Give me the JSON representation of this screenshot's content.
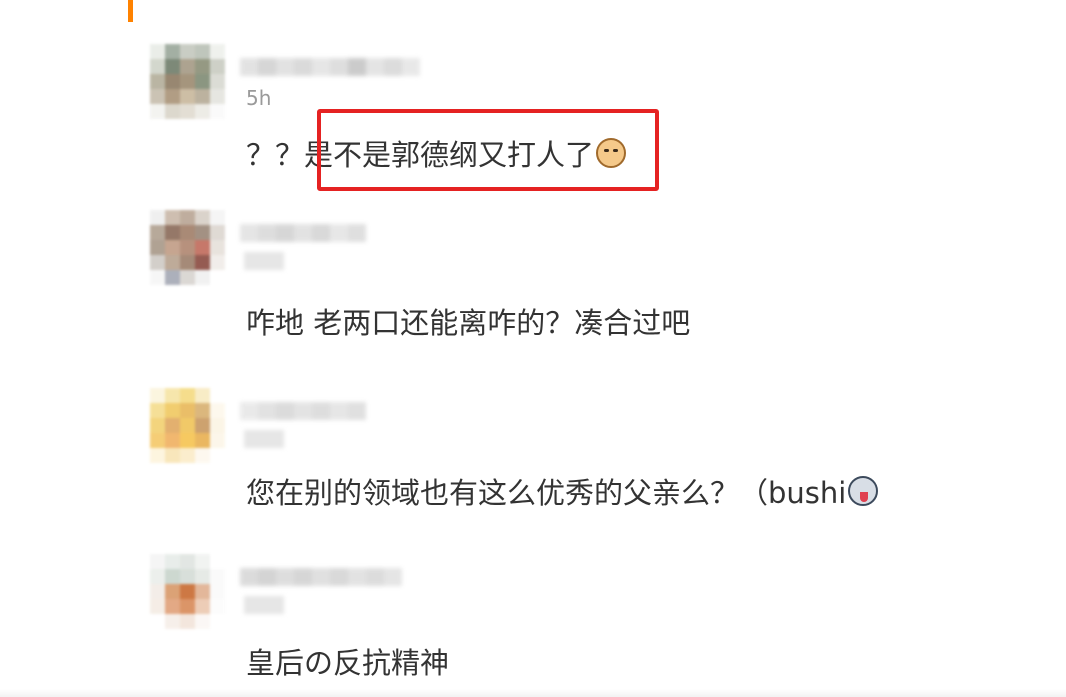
{
  "comments": [
    {
      "time": "5h",
      "text": "？？是不是郭德纲又打人了",
      "emoji": "cat-emoji"
    },
    {
      "time": "",
      "text": "咋地 老两口还能离咋的？凑合过吧",
      "emoji": ""
    },
    {
      "time": "",
      "text": "您在别的领域也有这么优秀的父亲么？（bushi",
      "emoji": "dog-tongue-emoji"
    },
    {
      "time": "",
      "text": "皇后の反抗精神",
      "emoji": ""
    }
  ],
  "colors": {
    "accent": "#ff8200",
    "highlight": "#e52222",
    "text": "#333333",
    "muted": "#9a9a9a"
  }
}
